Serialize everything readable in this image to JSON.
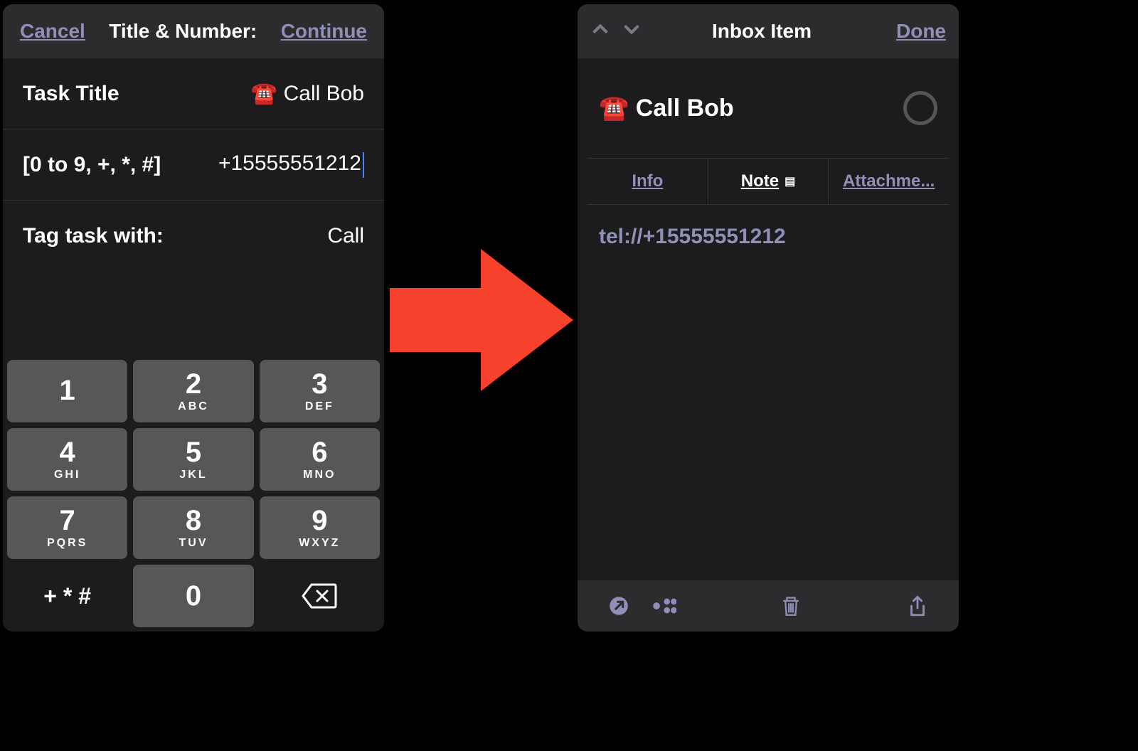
{
  "left": {
    "header": {
      "cancel": "Cancel",
      "title": "Title & Number:",
      "continue": "Continue"
    },
    "rows": {
      "task_title_label": "Task Title",
      "task_title_value": "☎️ Call Bob",
      "number_label": "[0 to 9, +, *, #]",
      "number_value": "+15555551212",
      "tag_label": "Tag task with:",
      "tag_value": "Call"
    },
    "keypad": [
      {
        "digit": "1",
        "letters": ""
      },
      {
        "digit": "2",
        "letters": "ABC"
      },
      {
        "digit": "3",
        "letters": "DEF"
      },
      {
        "digit": "4",
        "letters": "GHI"
      },
      {
        "digit": "5",
        "letters": "JKL"
      },
      {
        "digit": "6",
        "letters": "MNO"
      },
      {
        "digit": "7",
        "letters": "PQRS"
      },
      {
        "digit": "8",
        "letters": "TUV"
      },
      {
        "digit": "9",
        "letters": "WXYZ"
      }
    ],
    "fn_key": "+ * #",
    "zero_key": "0"
  },
  "right": {
    "header": {
      "title": "Inbox Item",
      "done": "Done"
    },
    "task_title": "☎️ Call Bob",
    "tabs": {
      "info": "Info",
      "note": "Note",
      "attach": "Attachme..."
    },
    "note_content": "tel://+15555551212"
  }
}
